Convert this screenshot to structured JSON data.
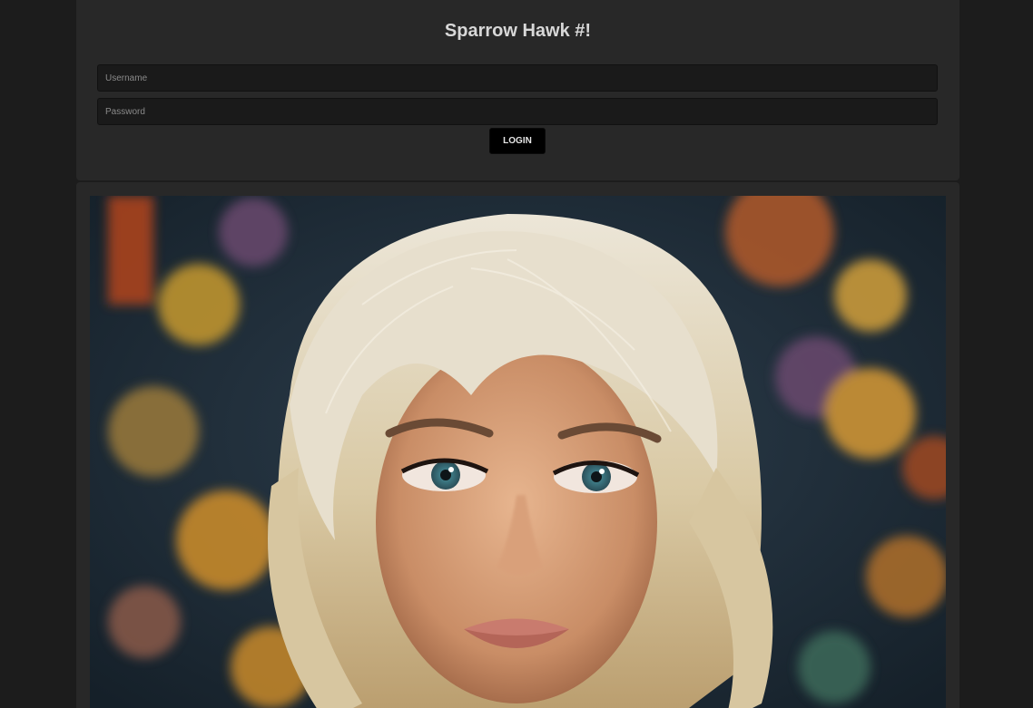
{
  "header": {
    "title": "Sparrow Hawk #!"
  },
  "login": {
    "username_placeholder": "Username",
    "password_placeholder": "Password",
    "login_label": "LOGIN"
  },
  "colors": {
    "page_background": "#1c1c1c",
    "panel_background": "#282828",
    "input_background": "#1a1a1a",
    "button_background": "#000000",
    "title_text": "#d8d8d8"
  }
}
